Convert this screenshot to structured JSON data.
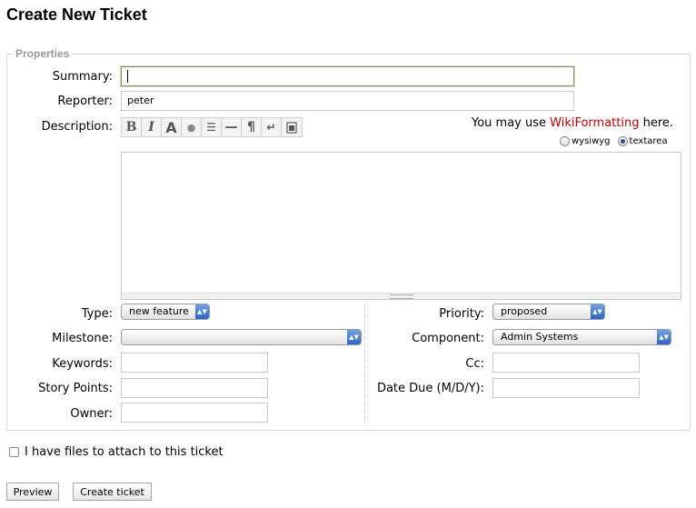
{
  "title": "Create New Ticket",
  "properties_legend": "Properties",
  "labels": {
    "summary": "Summary:",
    "reporter": "Reporter:",
    "description": "Description:",
    "type": "Type:",
    "milestone": "Milestone:",
    "keywords": "Keywords:",
    "story_points": "Story Points:",
    "owner": "Owner:",
    "priority": "Priority:",
    "component": "Component:",
    "cc": "Cc:",
    "date_due": "Date Due (M/D/Y):"
  },
  "values": {
    "summary": "",
    "reporter": "peter",
    "type": "new feature",
    "milestone": "",
    "priority": "proposed",
    "component": "Admin Systems",
    "keywords": "",
    "story_points": "",
    "owner": "",
    "cc": "",
    "date_due": ""
  },
  "toolbar": {
    "bold": "B",
    "italic": "I",
    "heading": "A",
    "link": "●",
    "code": "☰",
    "hr": "—",
    "paragraph": "¶",
    "linebreak": "↵",
    "image": "🔒"
  },
  "toolbar_icons": [
    "bold-icon",
    "italic-icon",
    "heading-icon",
    "link-icon",
    "code-block-icon",
    "horizontal-rule-icon",
    "paragraph-icon",
    "line-break-icon",
    "image-icon"
  ],
  "hint": {
    "prefix": "You may use ",
    "link": "WikiFormatting",
    "suffix": " here."
  },
  "editor_modes": {
    "wysiwyg": "wysiwyg",
    "textarea": "textarea",
    "selected": "textarea"
  },
  "attach_label": "I have files to attach to this ticket",
  "buttons": {
    "preview": "Preview",
    "create": "Create ticket"
  },
  "colors": {
    "link": "#bb0000",
    "legend": "#999999",
    "select_arrow": "#2b63c7"
  }
}
